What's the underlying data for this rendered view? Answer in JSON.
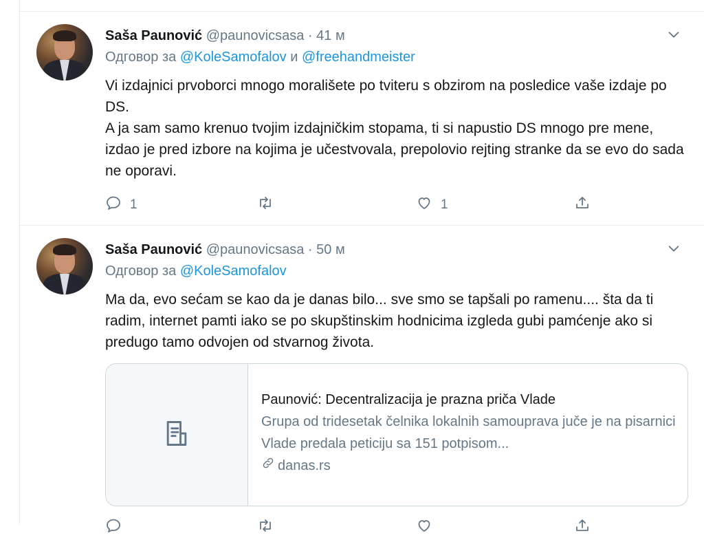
{
  "tweets": [
    {
      "name": "Saša Paunović",
      "handle": "@paunovicsasa",
      "separator": "·",
      "time": "41 м",
      "reply_prefix": "Одговор за",
      "reply_to_1": "@KoleSamofalov",
      "reply_conj": "и",
      "reply_to_2": "@freehandmeister",
      "text": "Vi izdajnici prvoborci mnogo morališete po tviteru s obzirom na posledice vaše izdaje po DS.\nA ja sam samo krenuo tvojim izdajničkim stopama, ti si napustio DS mnogo pre mene, izdao je pred izbore na kojima je učestvovala, prepolovio rejting stranke da se evo do sada ne oporavi.",
      "replies": "1",
      "retweets": "",
      "likes": "1"
    },
    {
      "name": "Saša Paunović",
      "handle": "@paunovicsasa",
      "separator": "·",
      "time": "50 м",
      "reply_prefix": "Одговор за",
      "reply_to_1": "@KoleSamofalov",
      "text": "Ma da, evo sećam se kao da je danas bilo... sve smo se tapšali po ramenu.... šta da ti radim, internet pamti iako se po skupštinskim hodnicima izgleda gubi pamćenje ako si predugo tamo odvojen od stvarnog života.",
      "card": {
        "title": "Paunović: Decentralizacija je prazna priča Vlade",
        "description": "Grupa od tridesetak čelnika lokalnih samouprava juče je na pisarnici Vlade predala peticiju sa 151 potpisom...",
        "domain": "danas.rs",
        "media_icon": "document-icon",
        "link_icon": "link-icon"
      }
    }
  ],
  "icons": {
    "reply": "reply-icon",
    "retweet": "retweet-icon",
    "like": "heart-icon",
    "share": "share-icon",
    "menu": "chevron-down-icon"
  },
  "colors": {
    "accent": "#1b95e0",
    "secondary_text": "#657786",
    "border": "#e6ecf0"
  }
}
